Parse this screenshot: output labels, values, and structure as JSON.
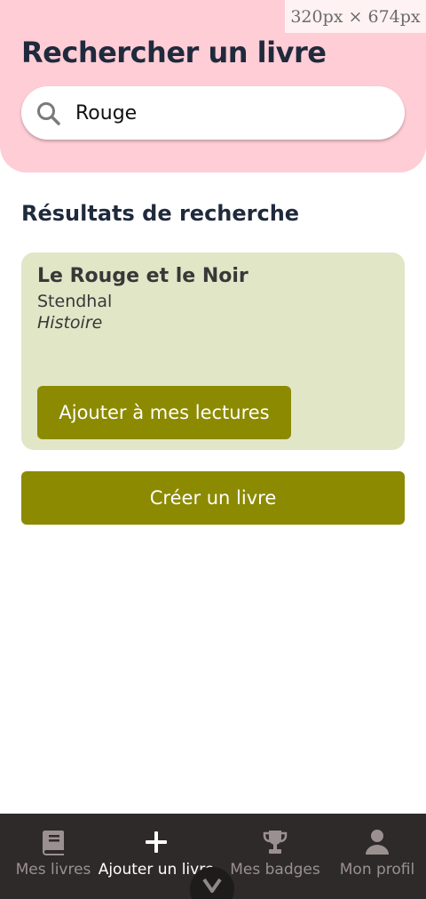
{
  "viewport_badge": "320px × 674px",
  "header": {
    "title": "Rechercher un livre",
    "search": {
      "value": "Rouge",
      "placeholder": "",
      "icon": "search-icon"
    }
  },
  "results": {
    "title": "Résultats de recherche",
    "items": [
      {
        "title": "Le Rouge et le Noir",
        "author": "Stendhal",
        "genre": "Histoire",
        "action_label": "Ajouter à mes lectures"
      }
    ]
  },
  "create_label": "Créer un livre",
  "nav": {
    "items": [
      {
        "label": "Mes livres",
        "icon": "book-icon",
        "active": false
      },
      {
        "label": "Ajouter un livre",
        "icon": "plus-icon",
        "active": true
      },
      {
        "label": "Mes badges",
        "icon": "trophy-icon",
        "active": false
      },
      {
        "label": "Mon profil",
        "icon": "user-icon",
        "active": false
      }
    ],
    "collapse_icon": "chevron-down-icon"
  },
  "colors": {
    "header_bg": "#ffcdd6",
    "card_bg": "#e1e6c7",
    "accent": "#8c8a00",
    "nav_bg": "#2e2a2a",
    "title_text": "#1f2a3c"
  }
}
